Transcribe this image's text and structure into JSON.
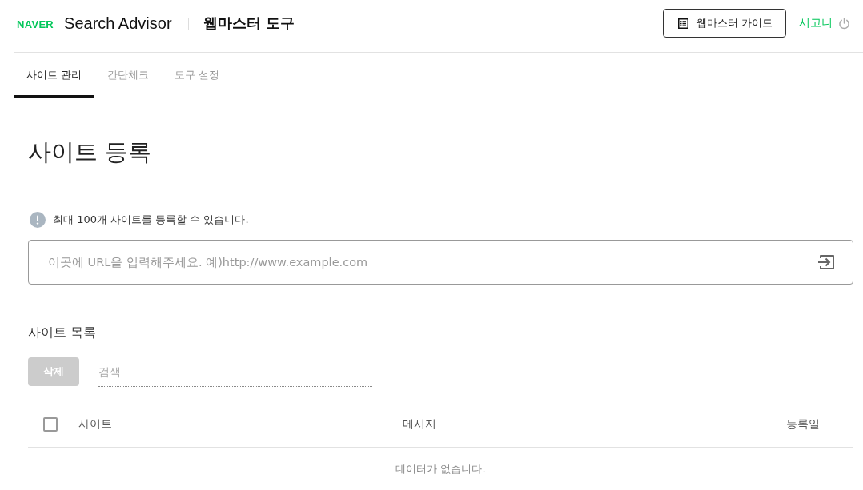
{
  "header": {
    "logo": "NAVER",
    "product": "Search Advisor",
    "section": "웹마스터 도구",
    "guide_button": "웹마스터 가이드",
    "user": "시고니"
  },
  "tabs": [
    {
      "label": "사이트 관리",
      "selected": true
    },
    {
      "label": "간단체크",
      "selected": false
    },
    {
      "label": "도구 설정",
      "selected": false
    }
  ],
  "register": {
    "title": "사이트 등록",
    "notice": "최대 100개 사이트를 등록할 수 있습니다.",
    "url_input": {
      "placeholder": "이곳에 URL을 입력해주세요. 예)http://www.example.com"
    }
  },
  "site_list": {
    "title": "사이트 목록",
    "delete_button": {
      "label": "삭제",
      "disabled": true
    },
    "search": {
      "placeholder": "검색"
    },
    "table": {
      "select_all": {
        "checked": false
      },
      "columns": [
        "사이트",
        "메시지",
        "등록일"
      ],
      "empty_message": "데이터가 없습니다."
    }
  }
}
